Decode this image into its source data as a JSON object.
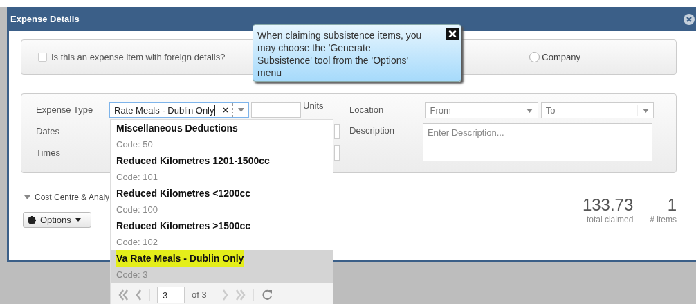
{
  "dialog": {
    "title": "Expense Details"
  },
  "tooltip": {
    "text": "When claiming subsistence items, you may choose the 'Generate Subsistence' tool from the 'Options' menu"
  },
  "foreign": {
    "label": "Is this an expense item with foreign details?",
    "checked": false
  },
  "payment": {
    "options": [
      {
        "label": "Company",
        "selected": false
      }
    ]
  },
  "form": {
    "expense_type": {
      "label": "Expense Type",
      "value": "Rate Meals - Dublin Only"
    },
    "units": {
      "label": "Units"
    },
    "dates": {
      "label": "Dates"
    },
    "times": {
      "label": "Times"
    },
    "location": {
      "label": "Location",
      "from": {
        "placeholder": "From"
      },
      "to": {
        "placeholder": "To"
      }
    },
    "description": {
      "label": "Description",
      "placeholder": "Enter Description..."
    }
  },
  "cost_centre": {
    "label": "Cost Centre & Analy"
  },
  "options_button": {
    "label": "Options"
  },
  "totals": [
    {
      "value": "133.73",
      "label": "total claimed"
    },
    {
      "value": "1",
      "label": "# items"
    }
  ],
  "dropdown": {
    "items": [
      {
        "name": "Miscellaneous Deductions",
        "code": "Code: 50",
        "selected": false,
        "highlighted": false
      },
      {
        "name": "Reduced Kilometres 1201-1500cc",
        "code": "Code: 101",
        "selected": false,
        "highlighted": false
      },
      {
        "name": "Reduced Kilometres <1200cc",
        "code": "Code: 100",
        "selected": false,
        "highlighted": false
      },
      {
        "name": "Reduced Kilometres >1500cc",
        "code": "Code: 102",
        "selected": false,
        "highlighted": false
      },
      {
        "name": "Va Rate Meals - Dublin Only",
        "code": "Code: 3",
        "selected": true,
        "highlighted": true
      }
    ],
    "pager": {
      "page": "3",
      "of": "of 3"
    }
  }
}
